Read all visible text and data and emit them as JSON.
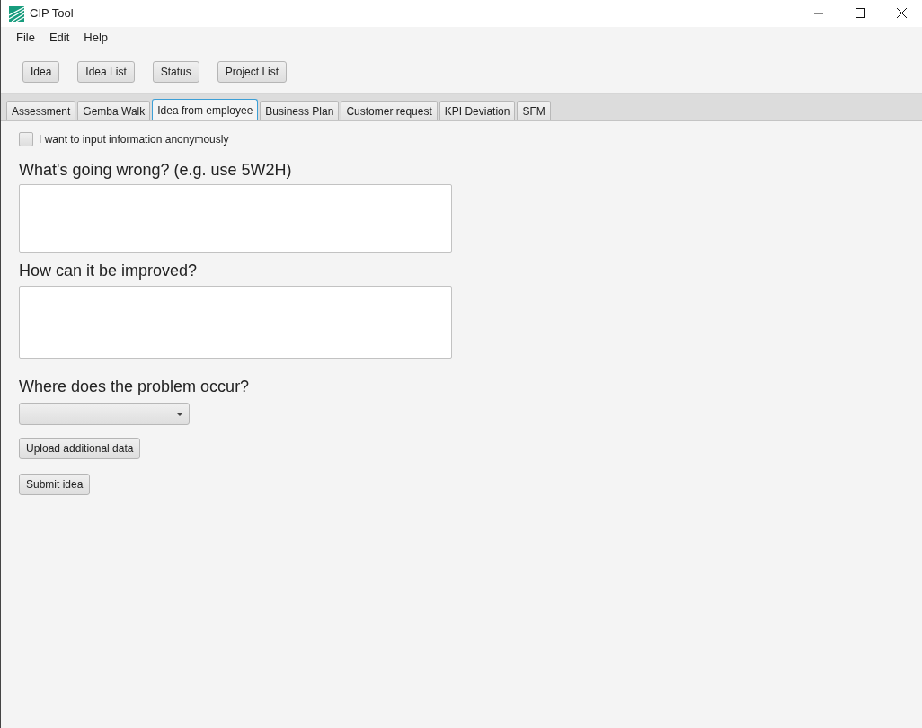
{
  "window": {
    "title": "CIP Tool"
  },
  "menu": [
    "File",
    "Edit",
    "Help"
  ],
  "toolbar": [
    "Idea",
    "Idea List",
    "Status",
    "Project List"
  ],
  "tabs": [
    {
      "label": "Assessment",
      "selected": false
    },
    {
      "label": "Gemba Walk",
      "selected": false
    },
    {
      "label": "Idea from employee",
      "selected": true
    },
    {
      "label": "Business Plan",
      "selected": false
    },
    {
      "label": "Customer request",
      "selected": false
    },
    {
      "label": "KPI Deviation",
      "selected": false
    },
    {
      "label": "SFM",
      "selected": false
    }
  ],
  "form": {
    "anonymous": {
      "label": "I want to input information anonymously",
      "checked": false
    },
    "problem_label": "What's going wrong? (e.g. use 5W2H)",
    "improvement_label": "How can it be improved?",
    "location_label": "Where does the problem occur?",
    "upload_button": "Upload additional data",
    "submit_button": "Submit idea"
  }
}
